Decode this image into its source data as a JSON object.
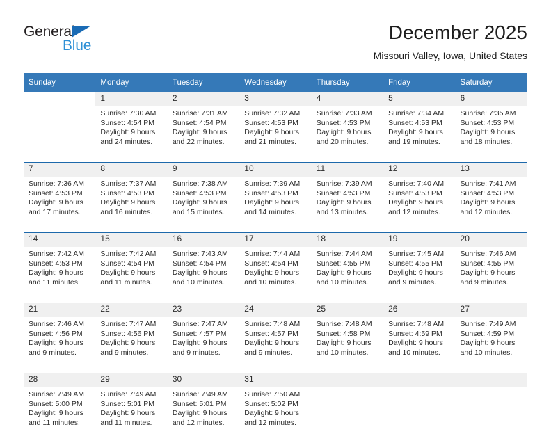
{
  "brand": {
    "name_part1": "General",
    "name_part2": "Blue",
    "triangle_color": "#1a6bb5",
    "blue_text_color": "#2d8fd5"
  },
  "header": {
    "title": "December 2025",
    "subtitle": "Missouri Valley, Iowa, United States"
  },
  "theme": {
    "header_blue": "#3579b8",
    "separator_blue": "#1d69ab",
    "daynum_band": "#f0f0f0"
  },
  "weekday_headers": [
    "Sunday",
    "Monday",
    "Tuesday",
    "Wednesday",
    "Thursday",
    "Friday",
    "Saturday"
  ],
  "weeks": [
    {
      "days": [
        {
          "num": "",
          "sunrise": "",
          "sunset": "",
          "daylight1": "",
          "daylight2": ""
        },
        {
          "num": "1",
          "sunrise": "Sunrise: 7:30 AM",
          "sunset": "Sunset: 4:54 PM",
          "daylight1": "Daylight: 9 hours",
          "daylight2": "and 24 minutes."
        },
        {
          "num": "2",
          "sunrise": "Sunrise: 7:31 AM",
          "sunset": "Sunset: 4:54 PM",
          "daylight1": "Daylight: 9 hours",
          "daylight2": "and 22 minutes."
        },
        {
          "num": "3",
          "sunrise": "Sunrise: 7:32 AM",
          "sunset": "Sunset: 4:53 PM",
          "daylight1": "Daylight: 9 hours",
          "daylight2": "and 21 minutes."
        },
        {
          "num": "4",
          "sunrise": "Sunrise: 7:33 AM",
          "sunset": "Sunset: 4:53 PM",
          "daylight1": "Daylight: 9 hours",
          "daylight2": "and 20 minutes."
        },
        {
          "num": "5",
          "sunrise": "Sunrise: 7:34 AM",
          "sunset": "Sunset: 4:53 PM",
          "daylight1": "Daylight: 9 hours",
          "daylight2": "and 19 minutes."
        },
        {
          "num": "6",
          "sunrise": "Sunrise: 7:35 AM",
          "sunset": "Sunset: 4:53 PM",
          "daylight1": "Daylight: 9 hours",
          "daylight2": "and 18 minutes."
        }
      ]
    },
    {
      "days": [
        {
          "num": "7",
          "sunrise": "Sunrise: 7:36 AM",
          "sunset": "Sunset: 4:53 PM",
          "daylight1": "Daylight: 9 hours",
          "daylight2": "and 17 minutes."
        },
        {
          "num": "8",
          "sunrise": "Sunrise: 7:37 AM",
          "sunset": "Sunset: 4:53 PM",
          "daylight1": "Daylight: 9 hours",
          "daylight2": "and 16 minutes."
        },
        {
          "num": "9",
          "sunrise": "Sunrise: 7:38 AM",
          "sunset": "Sunset: 4:53 PM",
          "daylight1": "Daylight: 9 hours",
          "daylight2": "and 15 minutes."
        },
        {
          "num": "10",
          "sunrise": "Sunrise: 7:39 AM",
          "sunset": "Sunset: 4:53 PM",
          "daylight1": "Daylight: 9 hours",
          "daylight2": "and 14 minutes."
        },
        {
          "num": "11",
          "sunrise": "Sunrise: 7:39 AM",
          "sunset": "Sunset: 4:53 PM",
          "daylight1": "Daylight: 9 hours",
          "daylight2": "and 13 minutes."
        },
        {
          "num": "12",
          "sunrise": "Sunrise: 7:40 AM",
          "sunset": "Sunset: 4:53 PM",
          "daylight1": "Daylight: 9 hours",
          "daylight2": "and 12 minutes."
        },
        {
          "num": "13",
          "sunrise": "Sunrise: 7:41 AM",
          "sunset": "Sunset: 4:53 PM",
          "daylight1": "Daylight: 9 hours",
          "daylight2": "and 12 minutes."
        }
      ]
    },
    {
      "days": [
        {
          "num": "14",
          "sunrise": "Sunrise: 7:42 AM",
          "sunset": "Sunset: 4:53 PM",
          "daylight1": "Daylight: 9 hours",
          "daylight2": "and 11 minutes."
        },
        {
          "num": "15",
          "sunrise": "Sunrise: 7:42 AM",
          "sunset": "Sunset: 4:54 PM",
          "daylight1": "Daylight: 9 hours",
          "daylight2": "and 11 minutes."
        },
        {
          "num": "16",
          "sunrise": "Sunrise: 7:43 AM",
          "sunset": "Sunset: 4:54 PM",
          "daylight1": "Daylight: 9 hours",
          "daylight2": "and 10 minutes."
        },
        {
          "num": "17",
          "sunrise": "Sunrise: 7:44 AM",
          "sunset": "Sunset: 4:54 PM",
          "daylight1": "Daylight: 9 hours",
          "daylight2": "and 10 minutes."
        },
        {
          "num": "18",
          "sunrise": "Sunrise: 7:44 AM",
          "sunset": "Sunset: 4:55 PM",
          "daylight1": "Daylight: 9 hours",
          "daylight2": "and 10 minutes."
        },
        {
          "num": "19",
          "sunrise": "Sunrise: 7:45 AM",
          "sunset": "Sunset: 4:55 PM",
          "daylight1": "Daylight: 9 hours",
          "daylight2": "and 9 minutes."
        },
        {
          "num": "20",
          "sunrise": "Sunrise: 7:46 AM",
          "sunset": "Sunset: 4:55 PM",
          "daylight1": "Daylight: 9 hours",
          "daylight2": "and 9 minutes."
        }
      ]
    },
    {
      "days": [
        {
          "num": "21",
          "sunrise": "Sunrise: 7:46 AM",
          "sunset": "Sunset: 4:56 PM",
          "daylight1": "Daylight: 9 hours",
          "daylight2": "and 9 minutes."
        },
        {
          "num": "22",
          "sunrise": "Sunrise: 7:47 AM",
          "sunset": "Sunset: 4:56 PM",
          "daylight1": "Daylight: 9 hours",
          "daylight2": "and 9 minutes."
        },
        {
          "num": "23",
          "sunrise": "Sunrise: 7:47 AM",
          "sunset": "Sunset: 4:57 PM",
          "daylight1": "Daylight: 9 hours",
          "daylight2": "and 9 minutes."
        },
        {
          "num": "24",
          "sunrise": "Sunrise: 7:48 AM",
          "sunset": "Sunset: 4:57 PM",
          "daylight1": "Daylight: 9 hours",
          "daylight2": "and 9 minutes."
        },
        {
          "num": "25",
          "sunrise": "Sunrise: 7:48 AM",
          "sunset": "Sunset: 4:58 PM",
          "daylight1": "Daylight: 9 hours",
          "daylight2": "and 10 minutes."
        },
        {
          "num": "26",
          "sunrise": "Sunrise: 7:48 AM",
          "sunset": "Sunset: 4:59 PM",
          "daylight1": "Daylight: 9 hours",
          "daylight2": "and 10 minutes."
        },
        {
          "num": "27",
          "sunrise": "Sunrise: 7:49 AM",
          "sunset": "Sunset: 4:59 PM",
          "daylight1": "Daylight: 9 hours",
          "daylight2": "and 10 minutes."
        }
      ]
    },
    {
      "days": [
        {
          "num": "28",
          "sunrise": "Sunrise: 7:49 AM",
          "sunset": "Sunset: 5:00 PM",
          "daylight1": "Daylight: 9 hours",
          "daylight2": "and 11 minutes."
        },
        {
          "num": "29",
          "sunrise": "Sunrise: 7:49 AM",
          "sunset": "Sunset: 5:01 PM",
          "daylight1": "Daylight: 9 hours",
          "daylight2": "and 11 minutes."
        },
        {
          "num": "30",
          "sunrise": "Sunrise: 7:49 AM",
          "sunset": "Sunset: 5:01 PM",
          "daylight1": "Daylight: 9 hours",
          "daylight2": "and 12 minutes."
        },
        {
          "num": "31",
          "sunrise": "Sunrise: 7:50 AM",
          "sunset": "Sunset: 5:02 PM",
          "daylight1": "Daylight: 9 hours",
          "daylight2": "and 12 minutes."
        },
        {
          "num": "",
          "sunrise": "",
          "sunset": "",
          "daylight1": "",
          "daylight2": ""
        },
        {
          "num": "",
          "sunrise": "",
          "sunset": "",
          "daylight1": "",
          "daylight2": ""
        },
        {
          "num": "",
          "sunrise": "",
          "sunset": "",
          "daylight1": "",
          "daylight2": ""
        }
      ]
    }
  ]
}
